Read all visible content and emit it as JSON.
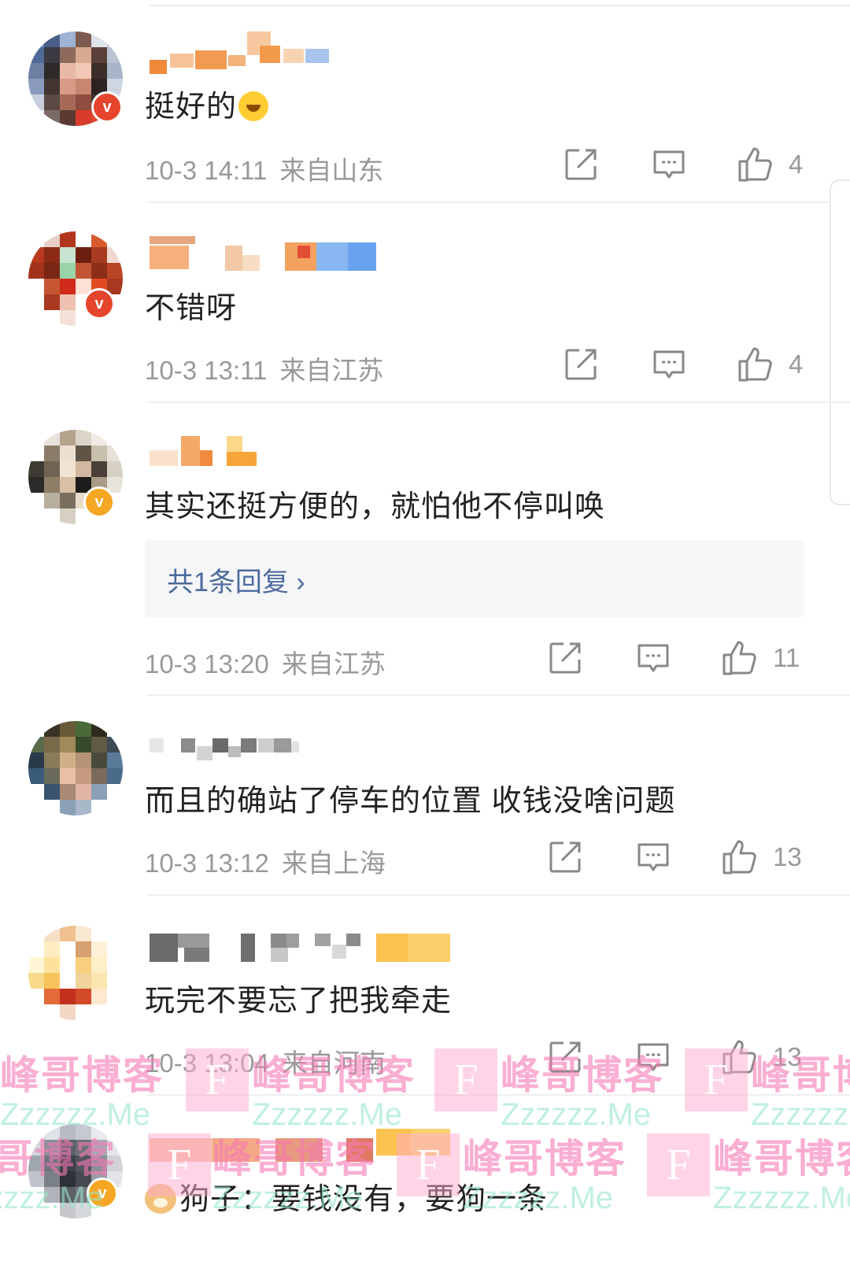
{
  "comments": [
    {
      "text": "挺好的",
      "emoji": "laugh-cry-emoji",
      "time": "10-3 14:11",
      "location": "来自山东",
      "likes": "4",
      "badge": "v",
      "badge_color": "#e5452d"
    },
    {
      "text": "不错呀",
      "time": "10-3 13:11",
      "location": "来自江苏",
      "likes": "4",
      "badge": "v",
      "badge_color": "#e5452d"
    },
    {
      "text": "其实还挺方便的，就怕他不停叫唤",
      "reply_summary": "共1条回复 ›",
      "time": "10-3 13:20",
      "location": "来自江苏",
      "likes": "11",
      "badge": "v",
      "badge_color": "#f5a623"
    },
    {
      "text": "而且的确站了停车的位置 收钱没啥问题",
      "time": "10-3 13:12",
      "location": "来自上海",
      "likes": "13"
    },
    {
      "text": "玩完不要忘了把我牵走",
      "time": "10-3 13:04",
      "location": "来自河南",
      "likes": "13"
    },
    {
      "text": "狗子：要钱没有，要狗一条",
      "emoji": "dog-emoji",
      "badge": "v",
      "badge_color": "#f5a623"
    }
  ],
  "icons": {
    "share": "share-icon",
    "comment": "comment-icon",
    "like": "thumbs-up-icon"
  },
  "colors": {
    "text": "#222222",
    "meta": "#999999",
    "reply_link": "#4d6a9c",
    "reply_bg": "#f5f6f8",
    "watermark_pink": "#f078aa",
    "watermark_green": "#96e6c8"
  },
  "watermark": {
    "cn": "峰哥博客",
    "en": "Zzzzzz.Me",
    "logo": "F"
  }
}
